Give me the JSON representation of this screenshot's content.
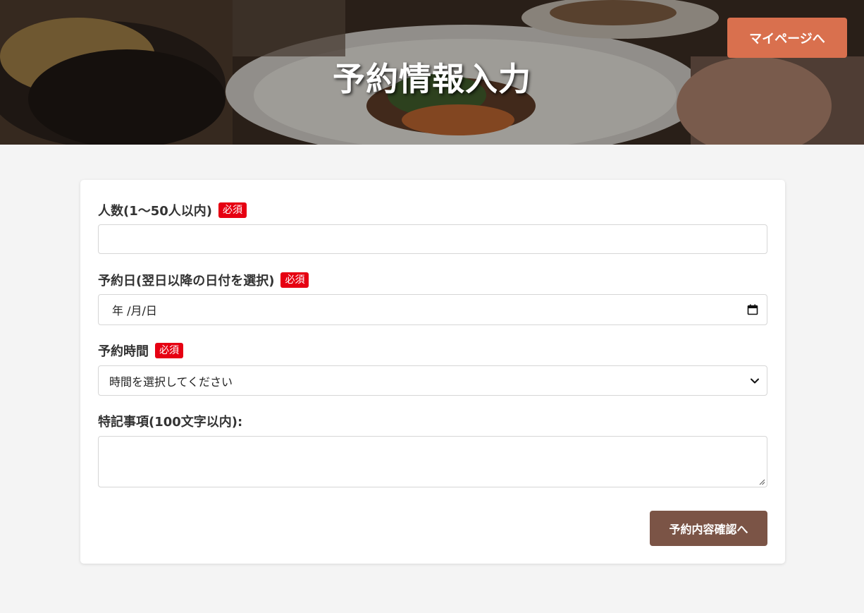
{
  "header": {
    "title": "予約情報入力",
    "mypage_button": "マイページへ",
    "accent_color": "#d9704e"
  },
  "form": {
    "required_badge": "必須",
    "people": {
      "label": "人数(1〜50人以内)",
      "value": "",
      "required": true
    },
    "date": {
      "label": "予約日(翌日以降の日付を選択)",
      "display_value": "年 /月/日",
      "required": true,
      "icon": "calendar-icon"
    },
    "time": {
      "label": "予約時間",
      "selected": "時間を選択してください",
      "required": true,
      "icon": "chevron-down-icon"
    },
    "notes": {
      "label": "特記事項(100文字以内):",
      "value": ""
    },
    "submit": {
      "label": "予約内容確認へ",
      "color": "#7b5446"
    }
  },
  "colors": {
    "required_badge": "#e60012",
    "page_background": "#f4f4f4"
  }
}
